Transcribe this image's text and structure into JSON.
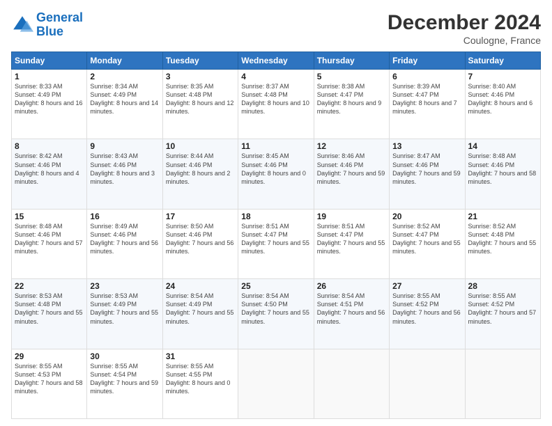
{
  "logo": {
    "line1": "General",
    "line2": "Blue"
  },
  "title": "December 2024",
  "location": "Coulogne, France",
  "headers": [
    "Sunday",
    "Monday",
    "Tuesday",
    "Wednesday",
    "Thursday",
    "Friday",
    "Saturday"
  ],
  "weeks": [
    [
      {
        "day": "1",
        "sunrise": "Sunrise: 8:33 AM",
        "sunset": "Sunset: 4:49 PM",
        "daylight": "Daylight: 8 hours and 16 minutes."
      },
      {
        "day": "2",
        "sunrise": "Sunrise: 8:34 AM",
        "sunset": "Sunset: 4:49 PM",
        "daylight": "Daylight: 8 hours and 14 minutes."
      },
      {
        "day": "3",
        "sunrise": "Sunrise: 8:35 AM",
        "sunset": "Sunset: 4:48 PM",
        "daylight": "Daylight: 8 hours and 12 minutes."
      },
      {
        "day": "4",
        "sunrise": "Sunrise: 8:37 AM",
        "sunset": "Sunset: 4:48 PM",
        "daylight": "Daylight: 8 hours and 10 minutes."
      },
      {
        "day": "5",
        "sunrise": "Sunrise: 8:38 AM",
        "sunset": "Sunset: 4:47 PM",
        "daylight": "Daylight: 8 hours and 9 minutes."
      },
      {
        "day": "6",
        "sunrise": "Sunrise: 8:39 AM",
        "sunset": "Sunset: 4:47 PM",
        "daylight": "Daylight: 8 hours and 7 minutes."
      },
      {
        "day": "7",
        "sunrise": "Sunrise: 8:40 AM",
        "sunset": "Sunset: 4:46 PM",
        "daylight": "Daylight: 8 hours and 6 minutes."
      }
    ],
    [
      {
        "day": "8",
        "sunrise": "Sunrise: 8:42 AM",
        "sunset": "Sunset: 4:46 PM",
        "daylight": "Daylight: 8 hours and 4 minutes."
      },
      {
        "day": "9",
        "sunrise": "Sunrise: 8:43 AM",
        "sunset": "Sunset: 4:46 PM",
        "daylight": "Daylight: 8 hours and 3 minutes."
      },
      {
        "day": "10",
        "sunrise": "Sunrise: 8:44 AM",
        "sunset": "Sunset: 4:46 PM",
        "daylight": "Daylight: 8 hours and 2 minutes."
      },
      {
        "day": "11",
        "sunrise": "Sunrise: 8:45 AM",
        "sunset": "Sunset: 4:46 PM",
        "daylight": "Daylight: 8 hours and 0 minutes."
      },
      {
        "day": "12",
        "sunrise": "Sunrise: 8:46 AM",
        "sunset": "Sunset: 4:46 PM",
        "daylight": "Daylight: 7 hours and 59 minutes."
      },
      {
        "day": "13",
        "sunrise": "Sunrise: 8:47 AM",
        "sunset": "Sunset: 4:46 PM",
        "daylight": "Daylight: 7 hours and 59 minutes."
      },
      {
        "day": "14",
        "sunrise": "Sunrise: 8:48 AM",
        "sunset": "Sunset: 4:46 PM",
        "daylight": "Daylight: 7 hours and 58 minutes."
      }
    ],
    [
      {
        "day": "15",
        "sunrise": "Sunrise: 8:48 AM",
        "sunset": "Sunset: 4:46 PM",
        "daylight": "Daylight: 7 hours and 57 minutes."
      },
      {
        "day": "16",
        "sunrise": "Sunrise: 8:49 AM",
        "sunset": "Sunset: 4:46 PM",
        "daylight": "Daylight: 7 hours and 56 minutes."
      },
      {
        "day": "17",
        "sunrise": "Sunrise: 8:50 AM",
        "sunset": "Sunset: 4:46 PM",
        "daylight": "Daylight: 7 hours and 56 minutes."
      },
      {
        "day": "18",
        "sunrise": "Sunrise: 8:51 AM",
        "sunset": "Sunset: 4:47 PM",
        "daylight": "Daylight: 7 hours and 55 minutes."
      },
      {
        "day": "19",
        "sunrise": "Sunrise: 8:51 AM",
        "sunset": "Sunset: 4:47 PM",
        "daylight": "Daylight: 7 hours and 55 minutes."
      },
      {
        "day": "20",
        "sunrise": "Sunrise: 8:52 AM",
        "sunset": "Sunset: 4:47 PM",
        "daylight": "Daylight: 7 hours and 55 minutes."
      },
      {
        "day": "21",
        "sunrise": "Sunrise: 8:52 AM",
        "sunset": "Sunset: 4:48 PM",
        "daylight": "Daylight: 7 hours and 55 minutes."
      }
    ],
    [
      {
        "day": "22",
        "sunrise": "Sunrise: 8:53 AM",
        "sunset": "Sunset: 4:48 PM",
        "daylight": "Daylight: 7 hours and 55 minutes."
      },
      {
        "day": "23",
        "sunrise": "Sunrise: 8:53 AM",
        "sunset": "Sunset: 4:49 PM",
        "daylight": "Daylight: 7 hours and 55 minutes."
      },
      {
        "day": "24",
        "sunrise": "Sunrise: 8:54 AM",
        "sunset": "Sunset: 4:49 PM",
        "daylight": "Daylight: 7 hours and 55 minutes."
      },
      {
        "day": "25",
        "sunrise": "Sunrise: 8:54 AM",
        "sunset": "Sunset: 4:50 PM",
        "daylight": "Daylight: 7 hours and 55 minutes."
      },
      {
        "day": "26",
        "sunrise": "Sunrise: 8:54 AM",
        "sunset": "Sunset: 4:51 PM",
        "daylight": "Daylight: 7 hours and 56 minutes."
      },
      {
        "day": "27",
        "sunrise": "Sunrise: 8:55 AM",
        "sunset": "Sunset: 4:52 PM",
        "daylight": "Daylight: 7 hours and 56 minutes."
      },
      {
        "day": "28",
        "sunrise": "Sunrise: 8:55 AM",
        "sunset": "Sunset: 4:52 PM",
        "daylight": "Daylight: 7 hours and 57 minutes."
      }
    ],
    [
      {
        "day": "29",
        "sunrise": "Sunrise: 8:55 AM",
        "sunset": "Sunset: 4:53 PM",
        "daylight": "Daylight: 7 hours and 58 minutes."
      },
      {
        "day": "30",
        "sunrise": "Sunrise: 8:55 AM",
        "sunset": "Sunset: 4:54 PM",
        "daylight": "Daylight: 7 hours and 59 minutes."
      },
      {
        "day": "31",
        "sunrise": "Sunrise: 8:55 AM",
        "sunset": "Sunset: 4:55 PM",
        "daylight": "Daylight: 8 hours and 0 minutes."
      },
      null,
      null,
      null,
      null
    ]
  ]
}
